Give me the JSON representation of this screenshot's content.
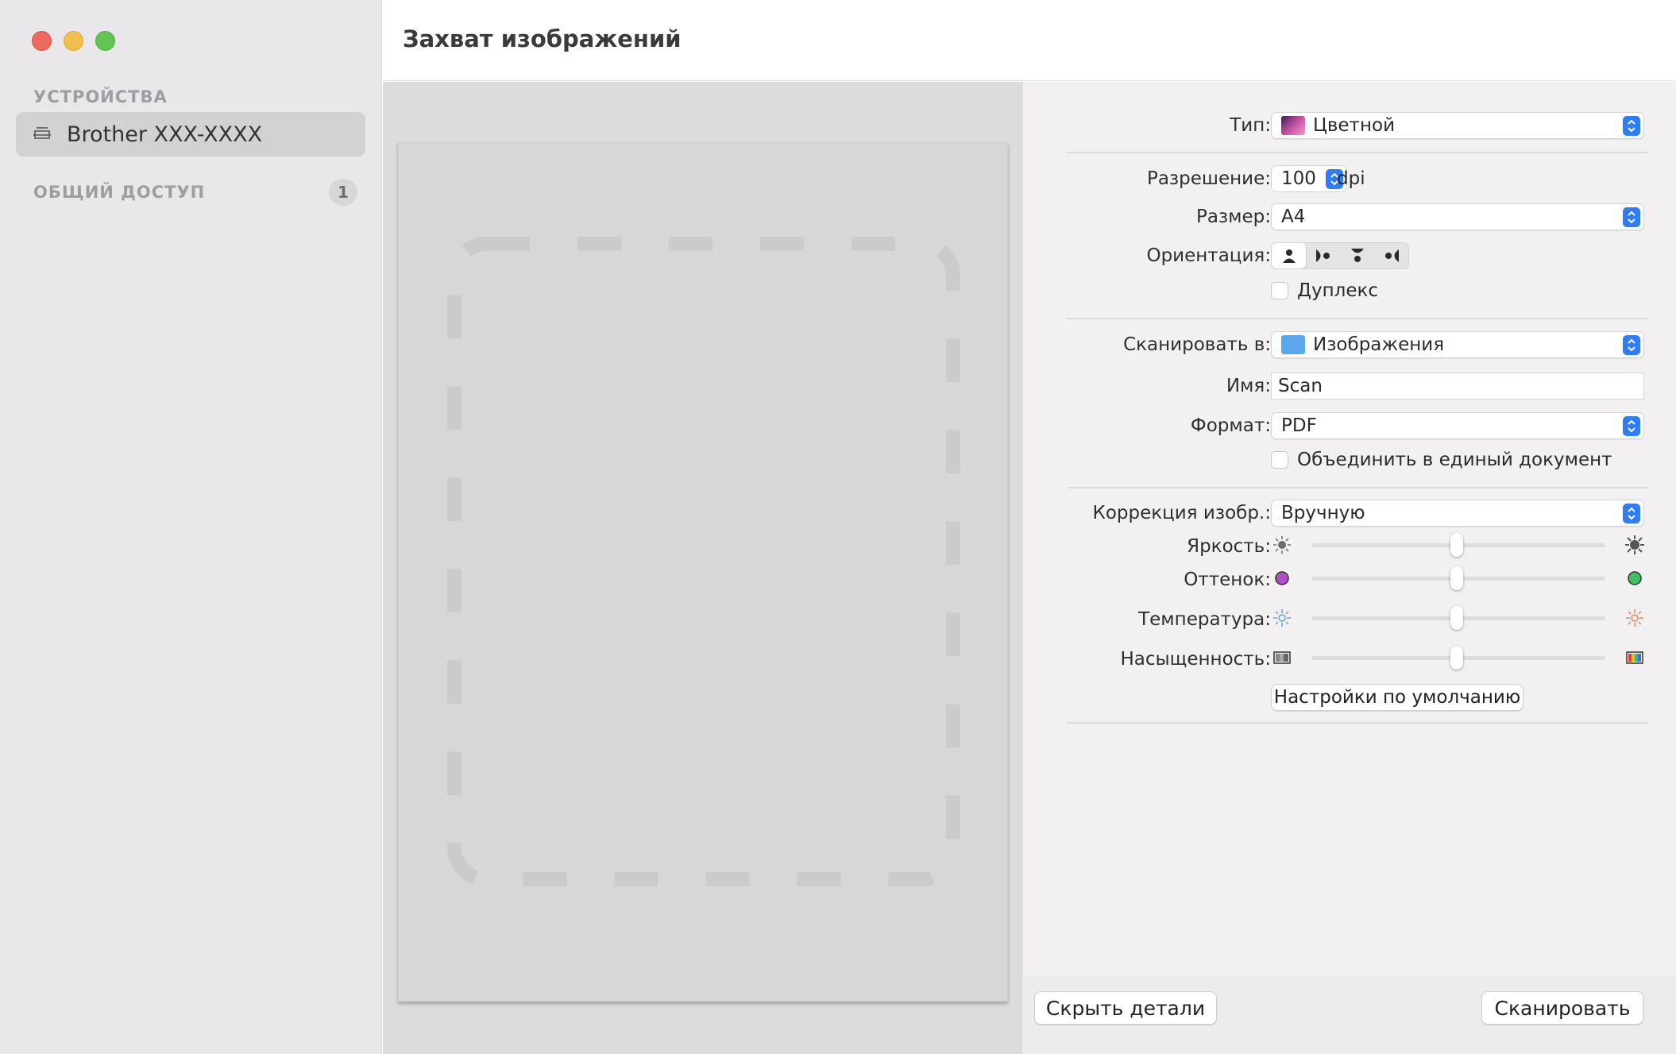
{
  "window": {
    "title": "Захват изображений"
  },
  "sidebar": {
    "devices_header": "УСТРОЙСТВА",
    "device_name": "Brother XXX-XXXX",
    "shared_header": "ОБЩИЙ ДОСТУП",
    "shared_count": "1"
  },
  "settings": {
    "type": {
      "label": "Тип:",
      "value": "Цветной"
    },
    "resolution": {
      "label": "Разрешение:",
      "value": "100",
      "unit": "dpi"
    },
    "size": {
      "label": "Размер:",
      "value": "A4"
    },
    "orientation": {
      "label": "Ориентация:",
      "selected_index": 0,
      "icons": [
        "portrait-icon",
        "landscape-left-icon",
        "upside-down-icon",
        "landscape-right-icon"
      ]
    },
    "duplex": {
      "label": "Дуплекс",
      "checked": false
    },
    "scan_to": {
      "label": "Сканировать в:",
      "value": "Изображения"
    },
    "name": {
      "label": "Имя:",
      "value": "Scan"
    },
    "format": {
      "label": "Формат:",
      "value": "PDF"
    },
    "combine": {
      "label": "Объединить в единый документ",
      "checked": false
    },
    "correction": {
      "label": "Коррекция изобр.:",
      "value": "Вручную"
    },
    "brightness": {
      "label": "Яркость:",
      "level": 0.5
    },
    "tint": {
      "label": "Оттенок:",
      "level": 0.5
    },
    "temperature": {
      "label": "Температура:",
      "level": 0.5
    },
    "saturation": {
      "label": "Насыщенность:",
      "level": 0.5
    },
    "defaults_button": "Настройки по умолчанию"
  },
  "footer": {
    "hide_details": "Скрыть детали",
    "scan": "Сканировать"
  },
  "colors": {
    "accent": "#2f7cf6",
    "tint_left": "#b24fc7",
    "tint_right": "#3fbf62",
    "sidebar_bg": "#e9e7ea"
  }
}
